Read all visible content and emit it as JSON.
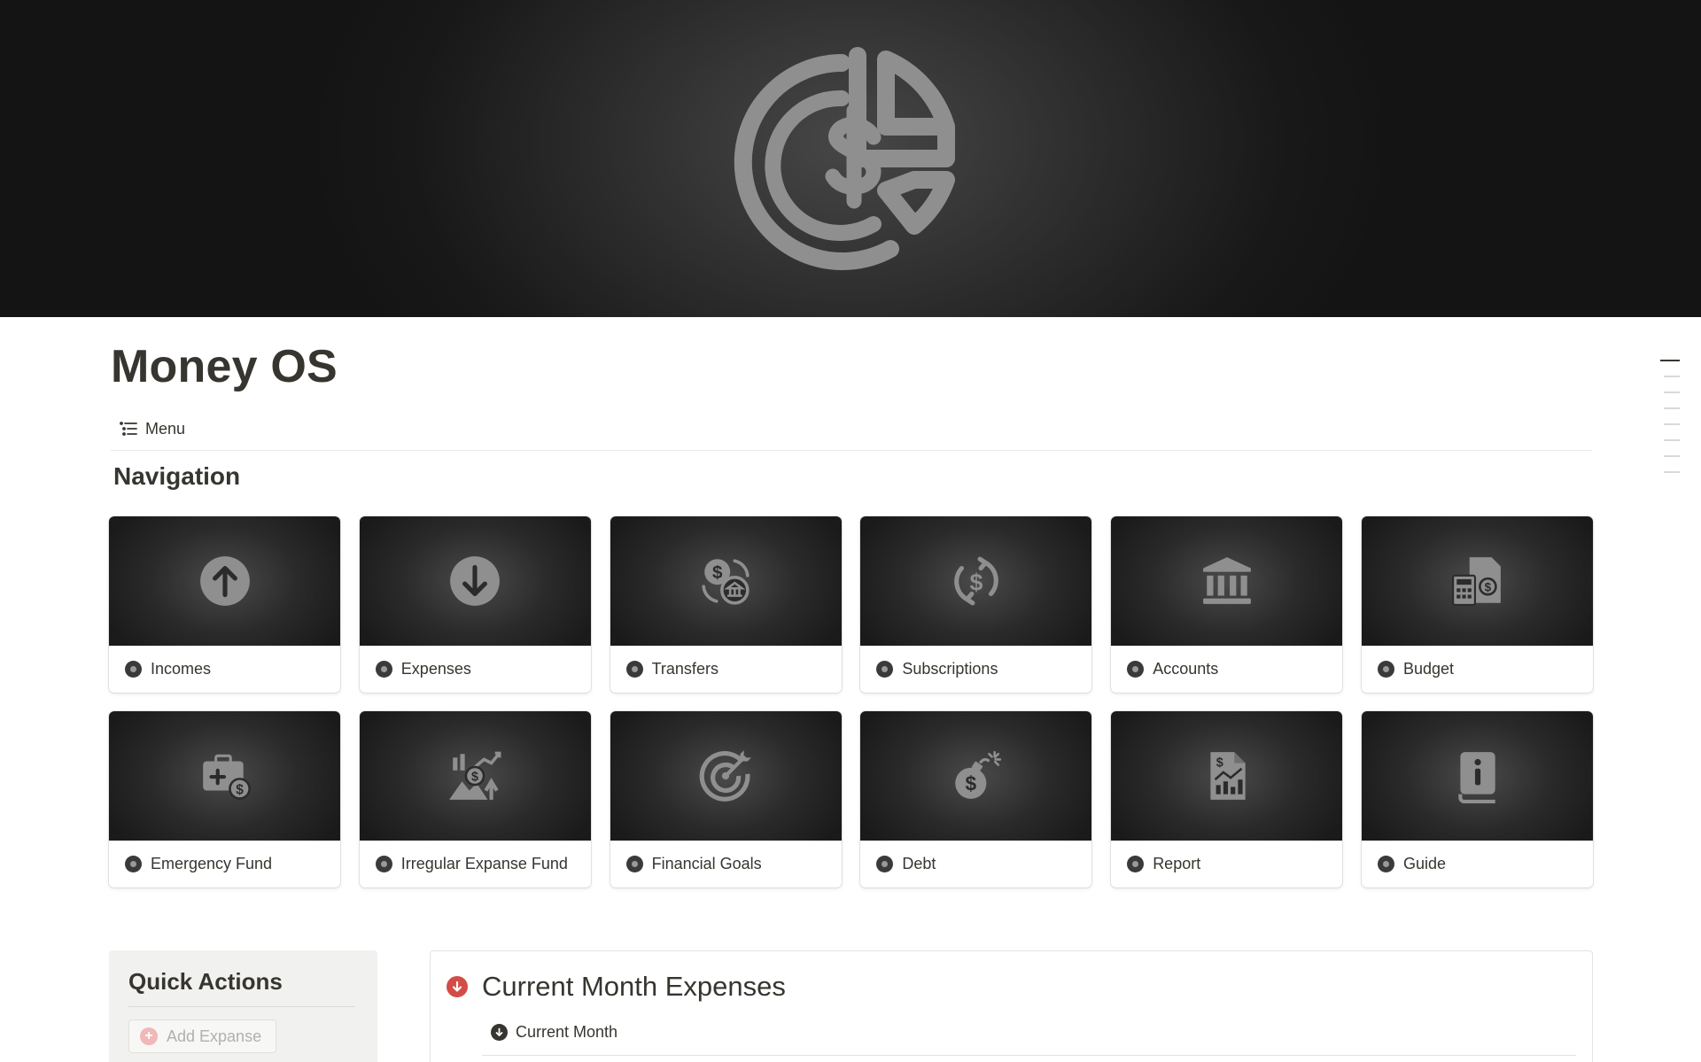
{
  "page": {
    "title": "Money OS",
    "toc_label": "Menu",
    "cover_icon": "dollar-pie-chart-icon"
  },
  "navigation": {
    "heading": "Navigation",
    "items": [
      {
        "label": "Incomes",
        "icon": "arrow-up-circle-icon"
      },
      {
        "label": "Expenses",
        "icon": "arrow-down-circle-icon"
      },
      {
        "label": "Transfers",
        "icon": "dollar-bank-transfer-icon"
      },
      {
        "label": "Subscriptions",
        "icon": "recurring-dollar-icon"
      },
      {
        "label": "Accounts",
        "icon": "bank-icon"
      },
      {
        "label": "Budget",
        "icon": "calculator-document-icon"
      },
      {
        "label": "Emergency Fund",
        "icon": "medical-kit-dollar-icon"
      },
      {
        "label": "Irregular Expanse Fund",
        "icon": "chart-money-landscape-icon"
      },
      {
        "label": "Financial Goals",
        "icon": "target-icon"
      },
      {
        "label": "Debt",
        "icon": "money-bomb-icon"
      },
      {
        "label": "Report",
        "icon": "financial-report-icon"
      },
      {
        "label": "Guide",
        "icon": "info-book-icon"
      }
    ]
  },
  "quick_actions": {
    "title": "Quick Actions",
    "add_expense_label": "Add Expanse"
  },
  "expenses": {
    "title": "Current Month Expenses",
    "view_label": "Current Month"
  },
  "colors": {
    "text": "#37352f",
    "accent_red": "#d44c47",
    "panel_bg": "#f1f1ef"
  }
}
